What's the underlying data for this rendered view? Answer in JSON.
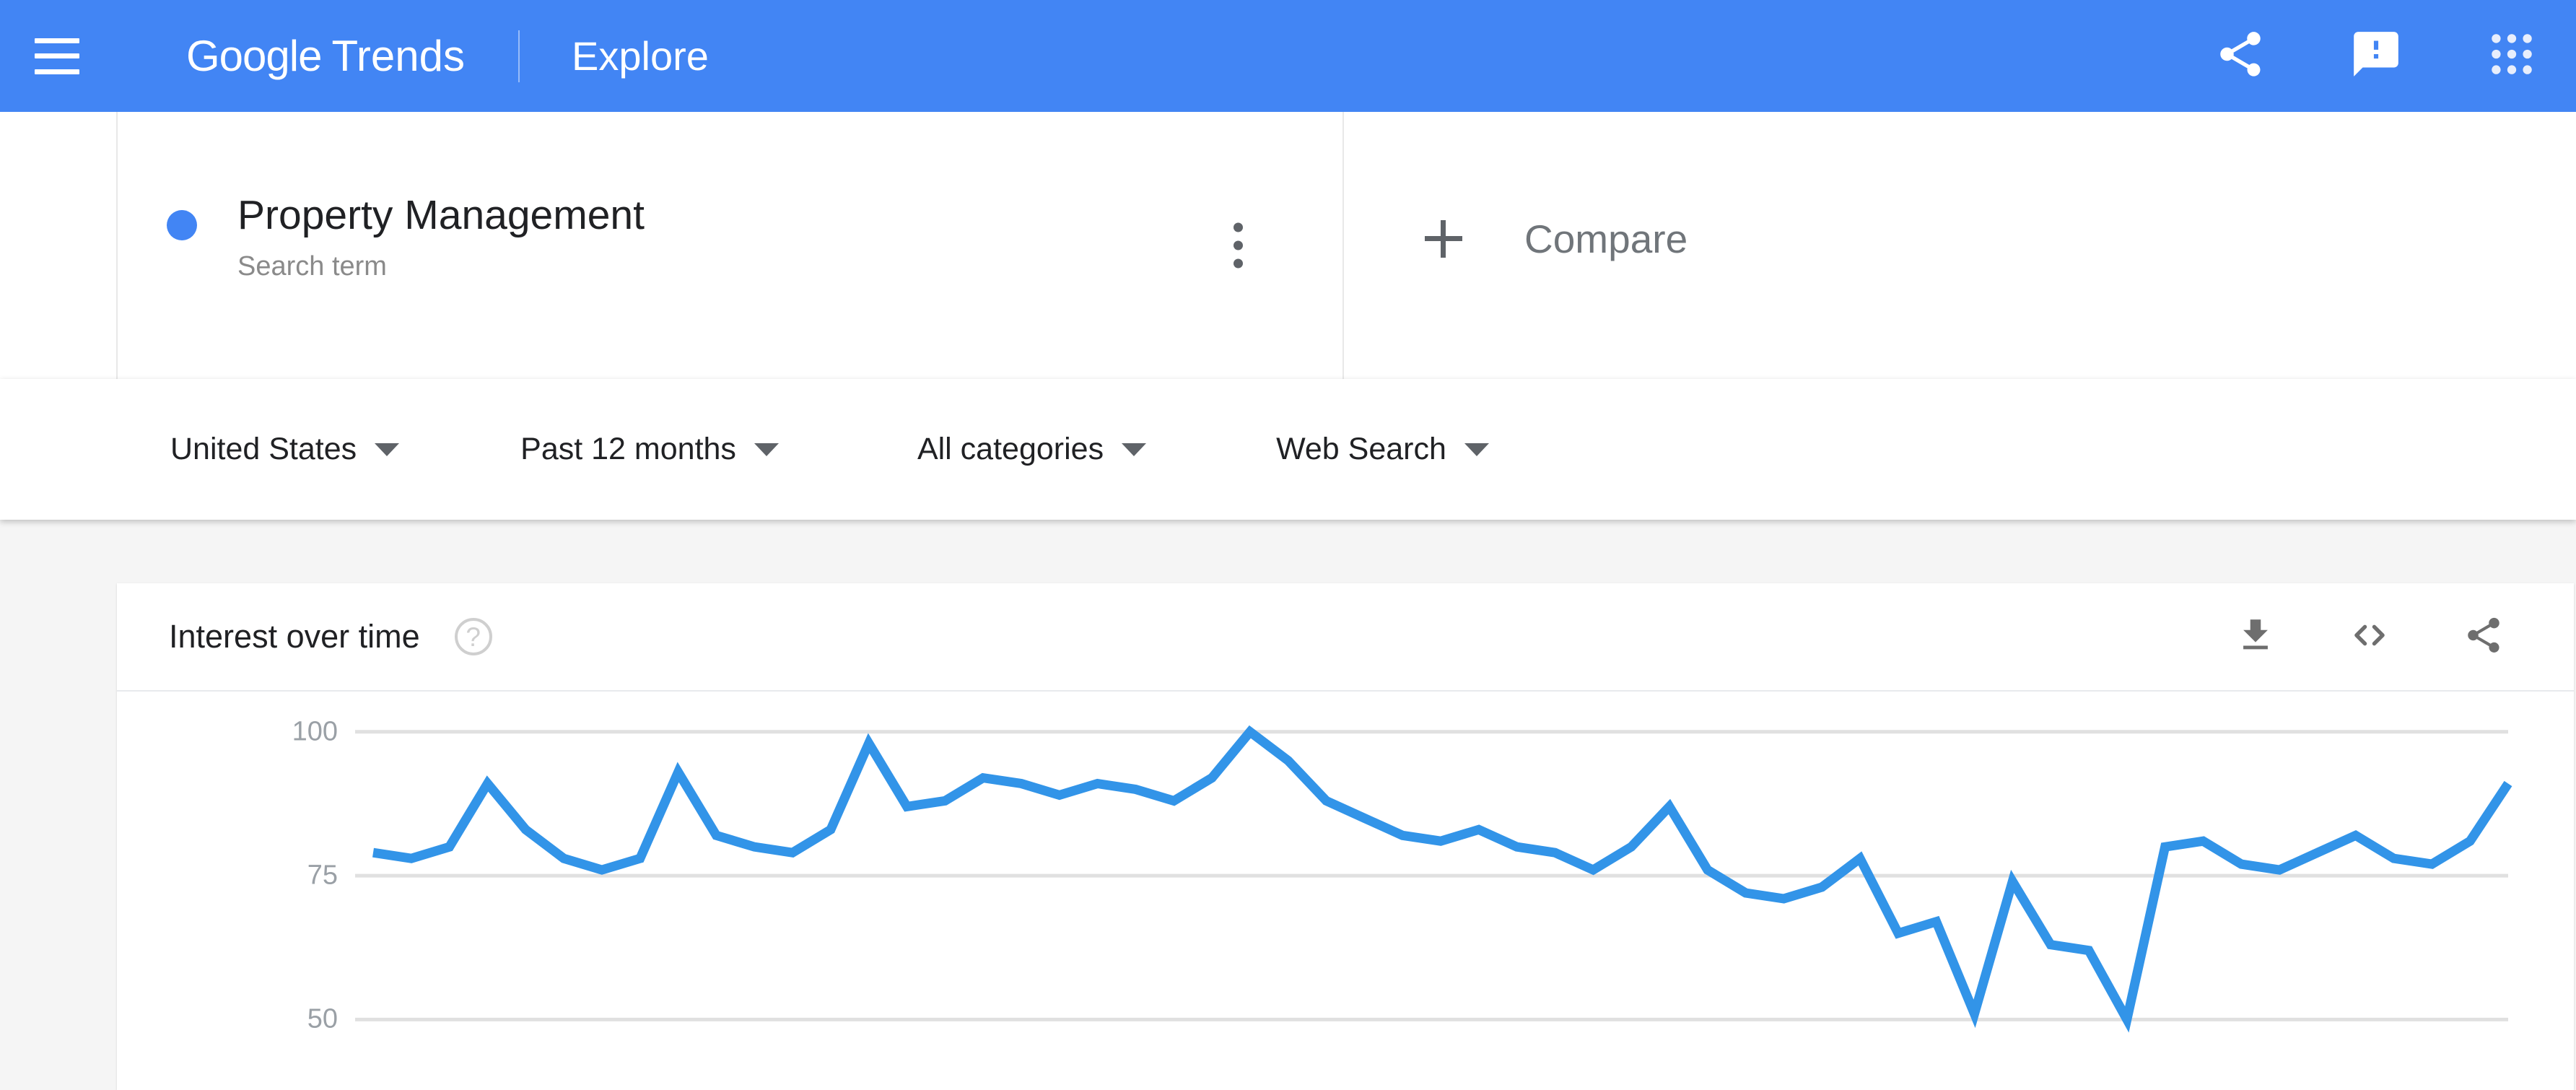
{
  "appbar": {
    "menu_icon": "hamburger-menu-icon",
    "brand_google": "Google",
    "brand_trends": "Trends",
    "explore_label": "Explore",
    "share_icon": "share-icon",
    "feedback_icon": "feedback-icon",
    "apps_icon": "apps-grid-icon",
    "background_color": "#4285f4"
  },
  "search_terms": [
    {
      "title": "Property Management",
      "subtitle": "Search term",
      "color": "#4285f4",
      "menu_icon": "more-vert-icon"
    }
  ],
  "compare": {
    "plus_icon": "plus-icon",
    "label": "Compare"
  },
  "filters": [
    {
      "label": "United States",
      "caret_icon": "chevron-down-icon"
    },
    {
      "label": "Past 12 months",
      "caret_icon": "chevron-down-icon"
    },
    {
      "label": "All categories",
      "caret_icon": "chevron-down-icon"
    },
    {
      "label": "Web Search",
      "caret_icon": "chevron-down-icon"
    }
  ],
  "chart_card": {
    "title": "Interest over time",
    "help_icon": "help-circle-icon",
    "help_label": "?",
    "download_icon": "download-icon",
    "embed_icon": "embed-code-icon",
    "share_icon": "share-icon"
  },
  "chart_data": {
    "type": "line",
    "title": "Interest over time",
    "xlabel": "",
    "ylabel": "",
    "ylim": [
      38,
      107
    ],
    "yticks": [
      100,
      75,
      50
    ],
    "grid": true,
    "legend": false,
    "line_color": "#3294e8",
    "series": [
      {
        "name": "Property Management",
        "color": "#3294e8",
        "values": [
          79,
          78,
          80,
          91,
          83,
          78,
          76,
          78,
          93,
          82,
          80,
          79,
          83,
          98,
          87,
          88,
          92,
          91,
          89,
          91,
          90,
          88,
          92,
          100,
          95,
          88,
          85,
          82,
          81,
          83,
          80,
          79,
          76,
          80,
          87,
          76,
          72,
          71,
          73,
          78,
          65,
          67,
          51,
          74,
          63,
          62,
          50,
          80,
          81,
          77,
          76,
          79,
          82,
          78,
          77,
          81,
          91
        ]
      }
    ]
  }
}
